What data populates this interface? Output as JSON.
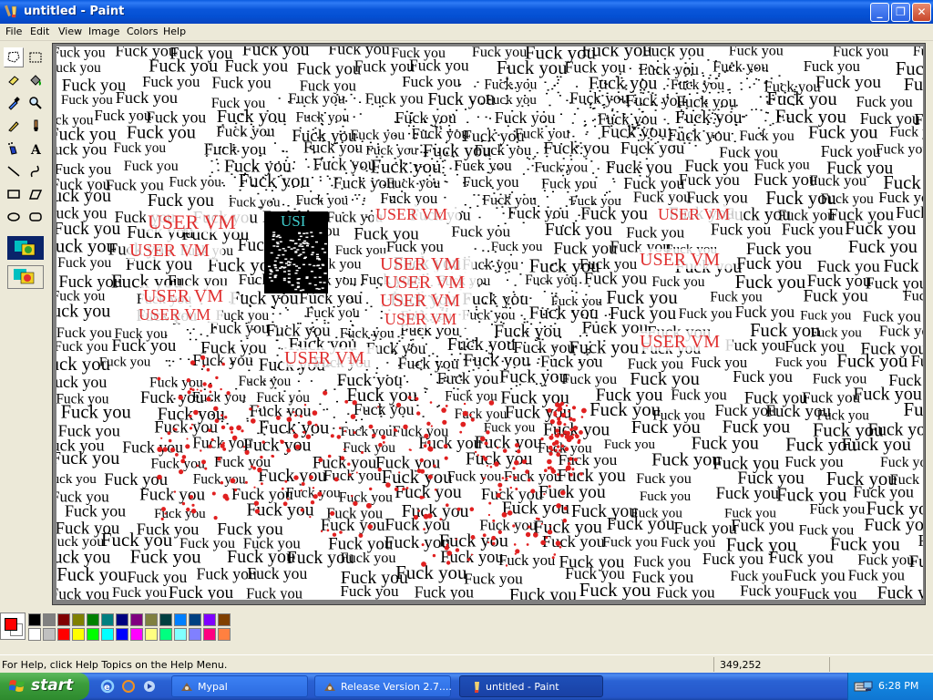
{
  "window": {
    "title": "untitled - Paint"
  },
  "menu": [
    "File",
    "Edit",
    "View",
    "Image",
    "Colors",
    "Help"
  ],
  "toolbox": {
    "tools": [
      "free-form-select",
      "select",
      "eraser",
      "fill-with-color",
      "pick-color",
      "magnifier",
      "pencil",
      "brush",
      "airbrush",
      "text",
      "line",
      "curve",
      "rectangle",
      "polygon",
      "ellipse",
      "rounded-rectangle"
    ]
  },
  "canvas": {
    "background_text": "Fuck you",
    "red_text": "USER VM",
    "inverted_text": "USI"
  },
  "palette": {
    "foreground": "#FF0000",
    "background": "#FFFFFF",
    "row1": [
      "#000000",
      "#808080",
      "#800000",
      "#808000",
      "#008000",
      "#008080",
      "#000080",
      "#800080",
      "#808040",
      "#004040",
      "#0080FF",
      "#004080",
      "#8000FF",
      "#804000"
    ],
    "row2": [
      "#FFFFFF",
      "#C0C0C0",
      "#FF0000",
      "#FFFF00",
      "#00FF00",
      "#00FFFF",
      "#0000FF",
      "#FF00FF",
      "#FFFF80",
      "#00FF80",
      "#80FFFF",
      "#8080FF",
      "#FF0080",
      "#FF8040"
    ]
  },
  "status": {
    "help": "For Help, click Help Topics on the Help Menu.",
    "coords": "349,252"
  },
  "taskbar": {
    "start": "start",
    "tasks": [
      "Mypal",
      "Release Version 2.7....",
      "untitled - Paint"
    ],
    "time": "6:28 PM"
  }
}
